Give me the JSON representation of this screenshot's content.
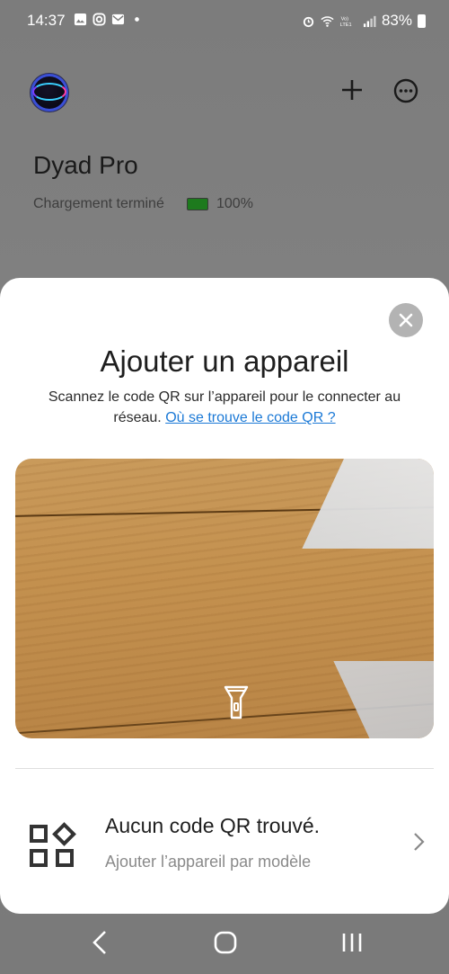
{
  "status_bar": {
    "time": "14:37",
    "battery_percent": "83%"
  },
  "header": {
    "device_name": "Dyad Pro",
    "charge_status": "Chargement terminé",
    "battery_level": "100%"
  },
  "sheet": {
    "title": "Ajouter un appareil",
    "description": "Scannez le code QR sur l’appareil pour le connecter au réseau.",
    "help_link": "Où se trouve le code QR ?",
    "qr_row": {
      "title": "Aucun code QR trouvé.",
      "subtitle": "Ajouter l’appareil par modèle"
    }
  },
  "colors": {
    "link": "#1b79d6",
    "battery_fill": "#1d7a1d",
    "close_bg": "#b3b3b3"
  }
}
